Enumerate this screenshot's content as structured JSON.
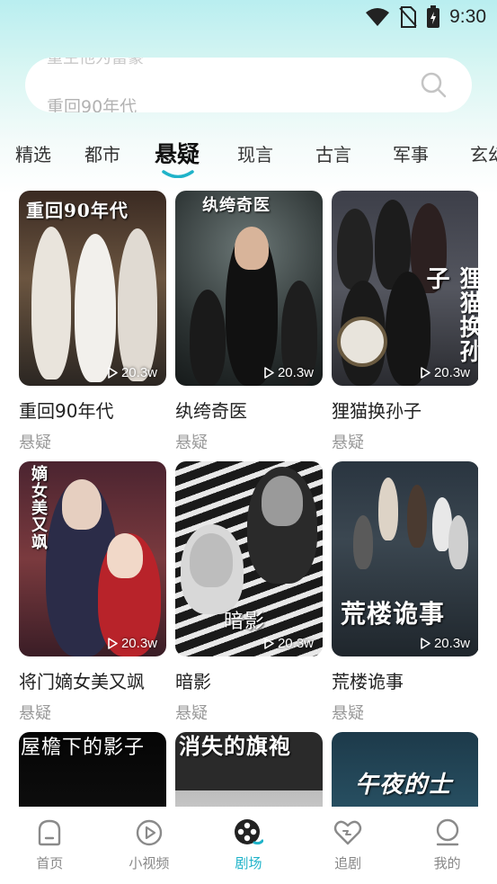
{
  "status_bar": {
    "time": "9:30"
  },
  "search": {
    "ghost_text": "重生他为富豪",
    "text": "重回90年代"
  },
  "tabs": [
    "精选",
    "都市",
    "悬疑",
    "现言",
    "古言",
    "军事",
    "玄幻"
  ],
  "active_tab": "悬疑",
  "dramas": [
    {
      "title": "重回90年代",
      "tag": "悬疑",
      "plays": "20.3w",
      "poster_text": "重回90年代"
    },
    {
      "title": "纨绔奇医",
      "tag": "悬疑",
      "plays": "20.3w",
      "poster_text": "纨绔奇医"
    },
    {
      "title": "狸猫换孙子",
      "tag": "悬疑",
      "plays": "20.3w",
      "poster_text": "狸猫换孙子"
    },
    {
      "title": "将门嫡女美又飒",
      "tag": "悬疑",
      "plays": "20.3w",
      "poster_text": "嫡女美又飒"
    },
    {
      "title": "暗影",
      "tag": "悬疑",
      "plays": "20.3w",
      "poster_text": "暗影"
    },
    {
      "title": "荒楼诡事",
      "tag": "悬疑",
      "plays": "20.3w",
      "poster_text": "荒楼诡事"
    },
    {
      "title": "",
      "tag": "",
      "plays": "",
      "poster_text": "屋檐下的影子"
    },
    {
      "title": "",
      "tag": "",
      "plays": "",
      "poster_text": "消失的旗袍"
    },
    {
      "title": "",
      "tag": "",
      "plays": "",
      "poster_text": "午夜的士"
    }
  ],
  "bottom_nav": [
    {
      "label": "首页",
      "icon": "home-icon"
    },
    {
      "label": "小视频",
      "icon": "play-circle-icon"
    },
    {
      "label": "剧场",
      "icon": "film-reel-icon"
    },
    {
      "label": "追剧",
      "icon": "heart-icon"
    },
    {
      "label": "我的",
      "icon": "profile-icon"
    }
  ],
  "colors": {
    "accent": "#1fb3c9",
    "tag_gray": "#999999"
  }
}
